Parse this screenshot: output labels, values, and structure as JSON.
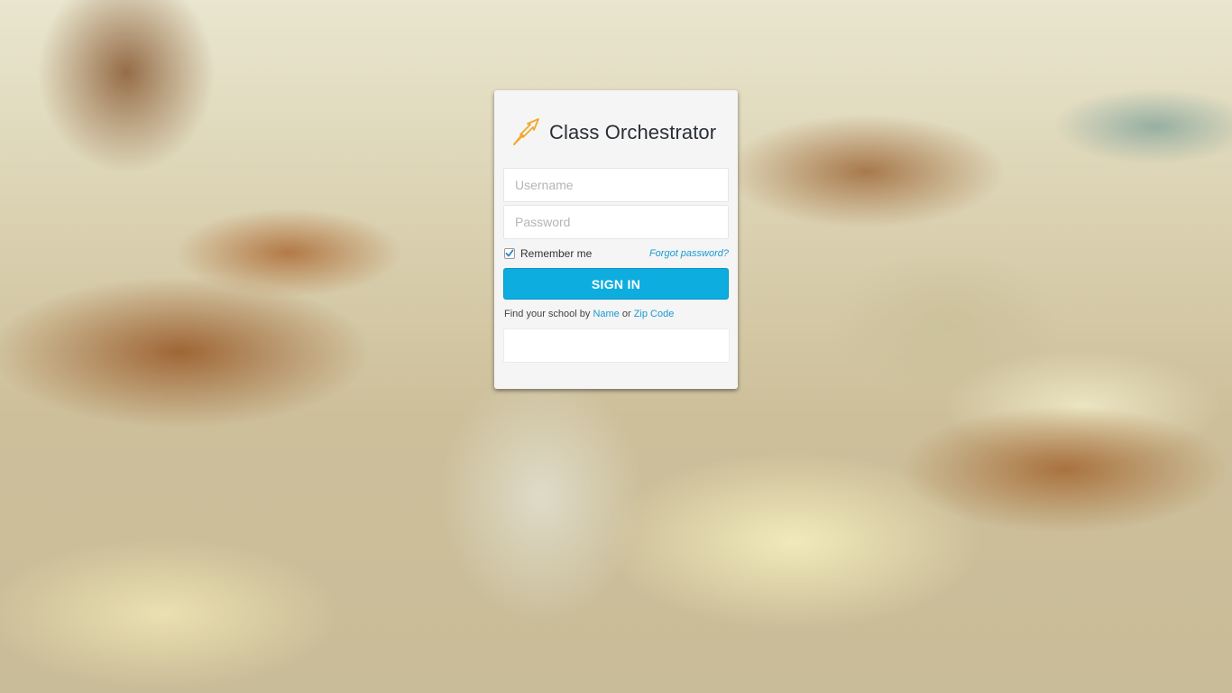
{
  "app": {
    "title": "Class Orchestrator",
    "logo_icon": "crossed-arrows-icon",
    "accent_color": "#0eaddf",
    "logo_color": "#f0a92c"
  },
  "login": {
    "username_placeholder": "Username",
    "password_placeholder": "Password",
    "remember_label": "Remember me",
    "remember_checked": true,
    "forgot_label": "Forgot password?",
    "signin_label": "SIGN IN"
  },
  "find_school": {
    "prefix": "Find your school by",
    "name_link": "Name",
    "connector": "or",
    "zip_link": "Zip Code",
    "search_value": ""
  }
}
